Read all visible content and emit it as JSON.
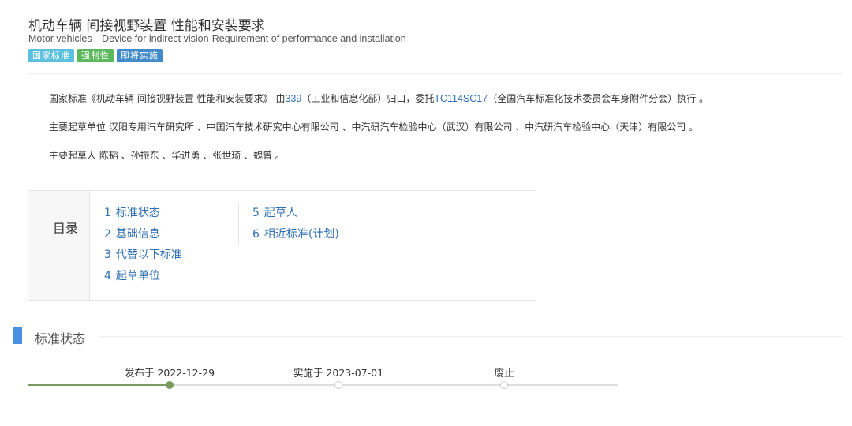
{
  "header": {
    "title_cn": "机动车辆 间接视野装置 性能和安装要求",
    "title_en": "Motor vehicles—Device for indirect vision-Requirement of performance and installation",
    "badges": [
      "国家标准",
      "强制性",
      "即将实施"
    ]
  },
  "description": {
    "line1": {
      "prefix": "国家标准《机动车辆 间接视野装置 性能和安装要求》 由",
      "org_code": "339",
      "middle": "（工业和信息化部）归口，委托",
      "committee_code": "TC114SC17",
      "suffix": "（全国汽车标准化技术委员会车身附件分会）执行 。"
    },
    "line2": "主要起草单位 汉阳专用汽车研究所 、中国汽车技术研究中心有限公司 、中汽研汽车检验中心（武汉）有限公司 、中汽研汽车检验中心（天津）有限公司 。",
    "line3": "主要起草人 陈韬 、孙振东 、华进勇 、张世琦 、魏曾 。"
  },
  "toc": {
    "label": "目录",
    "items": [
      {
        "num": "1",
        "text": "标准状态"
      },
      {
        "num": "2",
        "text": "基础信息"
      },
      {
        "num": "3",
        "text": "代替以下标准"
      },
      {
        "num": "4",
        "text": "起草单位"
      },
      {
        "num": "5",
        "text": "起草人"
      },
      {
        "num": "6",
        "text": "相近标准(计划)"
      }
    ]
  },
  "status_section": {
    "title": "标准状态",
    "accent_color": "#4a90e2",
    "timeline": [
      {
        "label": "发布于 2022-12-29",
        "state": "done"
      },
      {
        "label": "实施于 2023-07-01",
        "state": "pending"
      },
      {
        "label": "废止",
        "state": "pending"
      }
    ],
    "progress_color": "#7a9a5f"
  }
}
